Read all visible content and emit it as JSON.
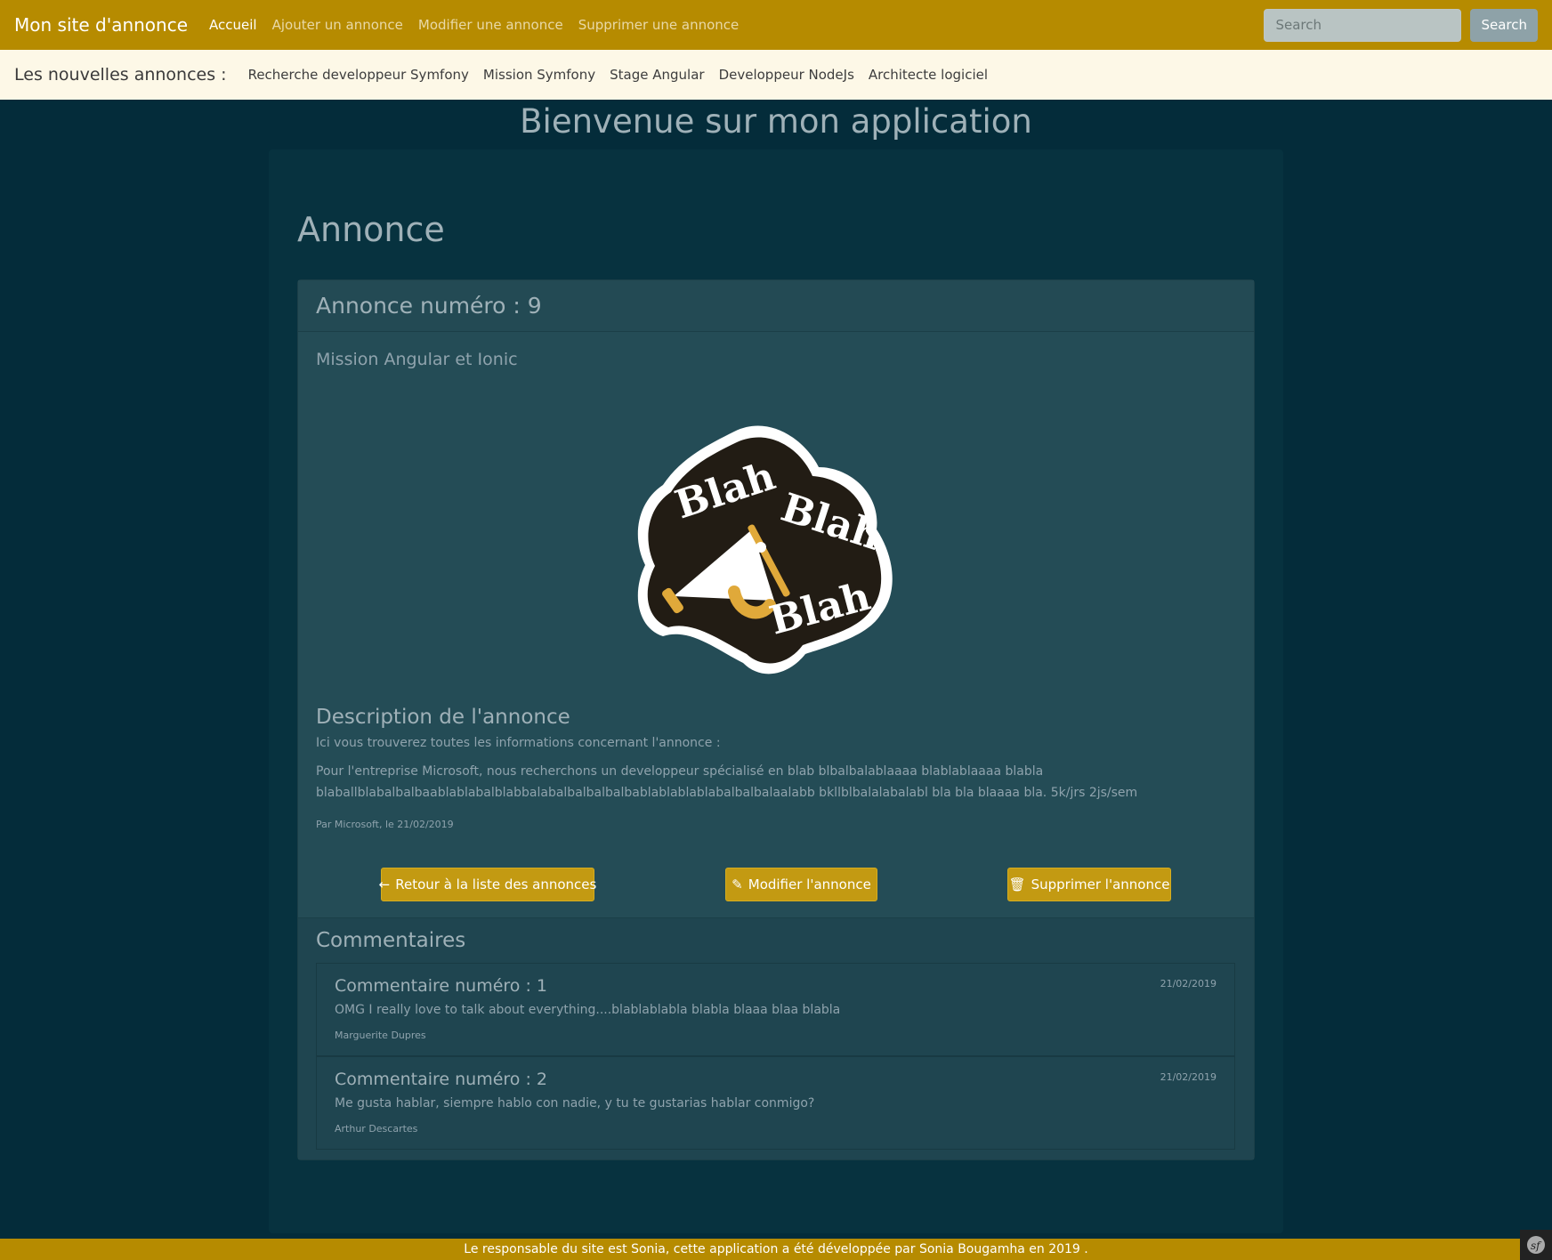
{
  "navbar": {
    "brand": "Mon site d'annonce",
    "links": [
      "Accueil",
      "Ajouter un annonce",
      "Modifier une annonce",
      "Supprimer une annonce"
    ],
    "search_placeholder": "Search",
    "search_button": "Search"
  },
  "subbar": {
    "title": "Les nouvelles annonces :",
    "links": [
      "Recherche developpeur Symfony",
      "Mission Symfony",
      "Stage Angular",
      "Developpeur NodeJs",
      "Architecte logiciel"
    ]
  },
  "page": {
    "heading": "Bienvenue sur mon application",
    "section_title": "Annonce"
  },
  "annonce": {
    "header": "Annonce numéro : 9",
    "title": "Mission Angular et Ionic",
    "image_words": [
      "Blah",
      "Blah",
      "Blah"
    ],
    "description_title": "Description de l'annonce",
    "description_intro": "Ici vous trouverez toutes les informations concernant l'annonce :",
    "description_body": "Pour l'entreprise Microsoft, nous recherchons un developpeur spécialisé en blab blbalbalablaaaa blablablaaaa blabla blaballblabalbalbaablablabalblabbalabalbalbalbalbablablablablabalbalbalaalabb bkllblbalalabalabl bla bla blaaaa bla. 5k/jrs 2js/sem",
    "meta": "Par Microsoft, le 21/02/2019"
  },
  "buttons": {
    "back": "Retour à la liste des annonces",
    "edit": "Modifier l'annonce",
    "delete": "Supprimer l'annonce"
  },
  "comments": {
    "title": "Commentaires",
    "items": [
      {
        "title": "Commentaire numéro : 1",
        "date": "21/02/2019",
        "text": "OMG I really love to talk about everything....blablablabla blabla blaaa blaa blabla",
        "author": "Marguerite Dupres"
      },
      {
        "title": "Commentaire numéro : 2",
        "date": "21/02/2019",
        "text": "Me gusta hablar, siempre hablo con nadie, y tu te gustarias hablar conmigo?",
        "author": "Arthur Descartes"
      }
    ]
  },
  "footer": {
    "text": "Le responsable du site est Sonia, cette application a été développée par Sonia Bougamha en 2019 ."
  },
  "colors": {
    "navbar": "#b68b00",
    "subbar": "#fdf8e7",
    "background": "#042c3a",
    "card": "#244c56",
    "button": "#c39a12"
  },
  "icons": {
    "back": "arrow-left-icon",
    "edit": "edit-icon",
    "delete": "trash-icon",
    "badge": "symfony-icon"
  }
}
